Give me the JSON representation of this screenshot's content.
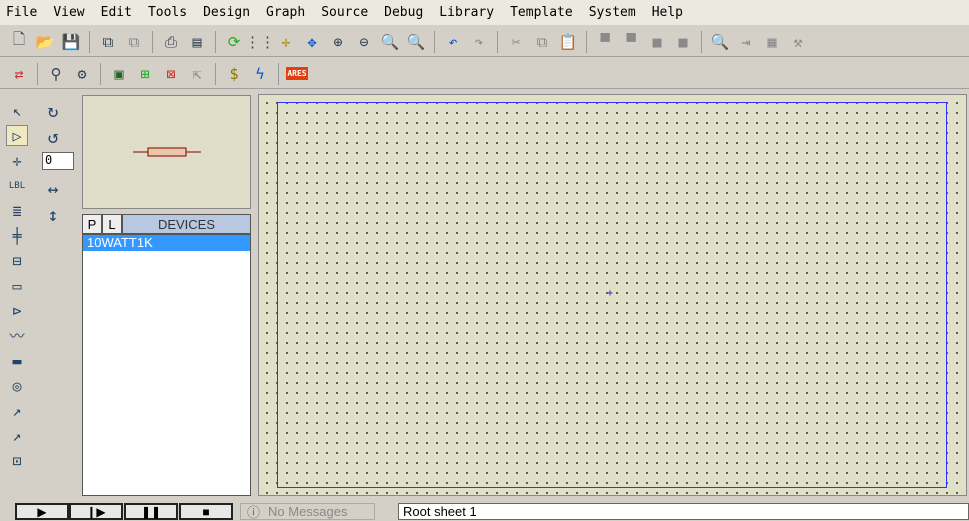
{
  "menu": [
    "File",
    "View",
    "Edit",
    "Tools",
    "Design",
    "Graph",
    "Source",
    "Debug",
    "Library",
    "Template",
    "System",
    "Help"
  ],
  "devices": {
    "p_label": "P",
    "l_label": "L",
    "header": "DEVICES",
    "items": [
      "10WATT1K"
    ]
  },
  "rotation_value": "0",
  "status": {
    "messages": "No Messages",
    "sheet": "Root sheet 1"
  },
  "ares_label": "ARES"
}
